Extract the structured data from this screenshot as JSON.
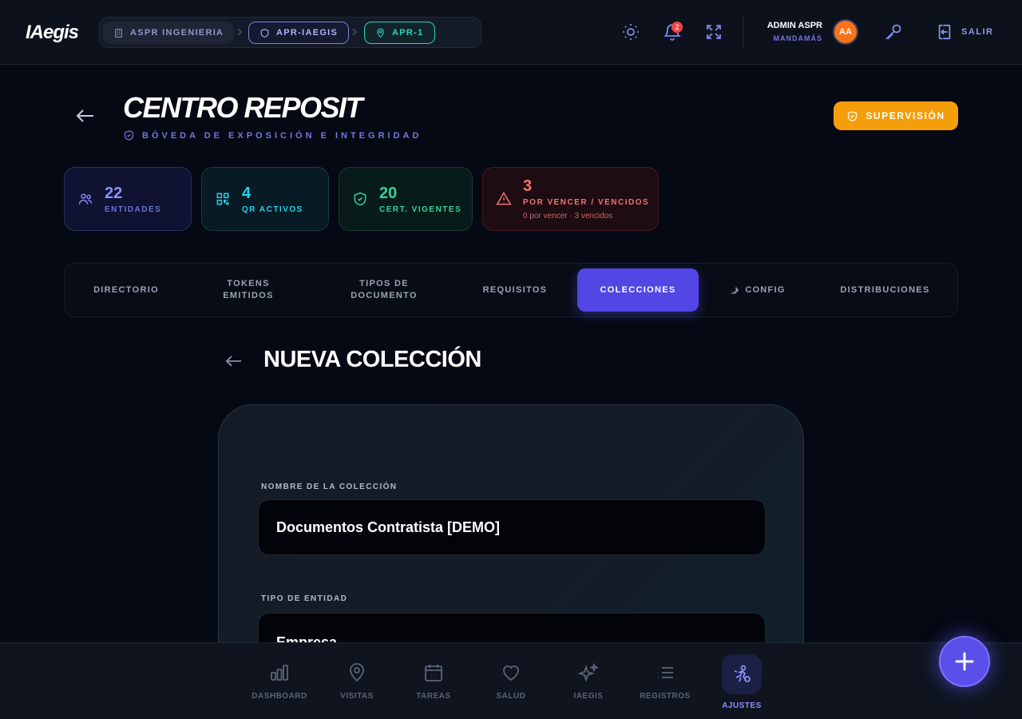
{
  "app": {
    "logo": "IAegis"
  },
  "breadcrumbs": [
    {
      "label": "ASPR INGENIERIA",
      "icon": "building-icon"
    },
    {
      "label": "APR-IAEGIS",
      "icon": "shield-icon"
    },
    {
      "label": "APR-1",
      "icon": "map-pin-icon"
    }
  ],
  "topbar": {
    "notifications_count": "2",
    "user_name": "ADMIN ASPR",
    "user_role": "MANDAMÁS",
    "avatar_initials": "AA",
    "logout_label": "SALIR"
  },
  "header": {
    "title": "CENTRO REPOSIT",
    "subtitle": "BÓVEDA DE EXPOSICIÓN E INTEGRIDAD",
    "badge_label": "SUPERVISIÓN"
  },
  "stats": [
    {
      "value": "22",
      "label": "ENTIDADES",
      "icon": "users-icon"
    },
    {
      "value": "4",
      "label": "QR ACTIVOS",
      "icon": "qr-icon"
    },
    {
      "value": "20",
      "label": "CERT. VIGENTES",
      "icon": "shield-check-icon"
    },
    {
      "value": "3",
      "label": "POR VENCER / VENCIDOS",
      "sub": "0 por vencer · 3 vencidos",
      "icon": "warning-icon"
    }
  ],
  "tabs": [
    {
      "label": "DIRECTORIO"
    },
    {
      "label": "TOKENS EMITIDOS"
    },
    {
      "label": "TIPOS DE DOCUMENTO"
    },
    {
      "label": "REQUISITOS"
    },
    {
      "label": "COLECCIONES",
      "active": true
    },
    {
      "label": "CONFIG",
      "icon": "wrench-icon"
    },
    {
      "label": "DISTRIBUCIONES"
    }
  ],
  "form": {
    "title": "NUEVA COLECCIÓN",
    "name_label": "NOMBRE DE LA COLECCIÓN",
    "name_value": "Documentos Contratista [DEMO]",
    "entity_label": "TIPO DE ENTIDAD",
    "entity_value": "Empresa"
  },
  "bottom_nav": [
    {
      "label": "DASHBOARD",
      "icon": "bar-chart-icon"
    },
    {
      "label": "VISITAS",
      "icon": "map-pin-icon"
    },
    {
      "label": "TAREAS",
      "icon": "calendar-icon"
    },
    {
      "label": "SALUD",
      "icon": "heart-icon"
    },
    {
      "label": "IAEGIS",
      "icon": "sparkles-icon"
    },
    {
      "label": "REGISTROS",
      "icon": "list-icon"
    },
    {
      "label": "AJUSTES",
      "icon": "settings-person-icon",
      "active": true
    }
  ],
  "colors": {
    "accent": "#5246e5",
    "warning": "#f59e0b",
    "danger": "#f87171",
    "teal": "#2dd4bf",
    "background": "#050913"
  }
}
